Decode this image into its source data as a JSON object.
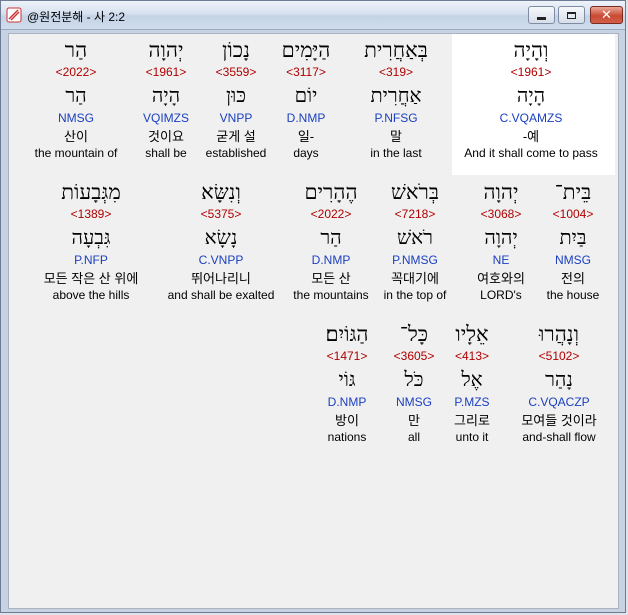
{
  "window": {
    "title": "@원전분해 - 사 2:2"
  },
  "rows": [
    {
      "words": [
        {
          "heb": "הַר",
          "strong": "<2022>",
          "lemma": "הַר",
          "parse": "NMSG",
          "kor": "산이",
          "eng": "the mountain of"
        },
        {
          "heb": "יְהוָה",
          "strong": "<1961>",
          "lemma": "הָיָה",
          "parse": "VQIMZS",
          "kor": "것이요",
          "eng": "shall be"
        },
        {
          "heb": "נָכוֹן",
          "strong": "<3559>",
          "lemma": "כּוּן",
          "parse": "VNPP",
          "kor": "굳게 설",
          "eng": "established"
        },
        {
          "heb": "הַיָּמִים",
          "strong": "<3117>",
          "lemma": "יוֹם",
          "parse": "D.NMP",
          "kor": "일-",
          "eng": "days"
        },
        {
          "heb": "בְּאַחֲרִית",
          "strong": "<319>",
          "lemma": "אַחֲרִית",
          "parse": "P.NFSG",
          "kor": "말",
          "eng": "in the last"
        },
        {
          "heb": "וְהָיָה",
          "strong": "<1961>",
          "lemma": "הָיָה",
          "parse": "C.VQAMZS",
          "kor": "-예",
          "eng": "And it shall come to pass"
        }
      ]
    },
    {
      "words": [
        {
          "heb": "מִגְּבָעוֹת",
          "strong": "<1389>",
          "lemma": "גִּבְעָה",
          "parse": "P.NFP",
          "kor": "모든 작은 산 위에",
          "eng": "above the hills"
        },
        {
          "heb": "וְנִשָּׂא",
          "strong": "<5375>",
          "lemma": "נָשָׂא",
          "parse": "C.VNPP",
          "kor": "뛰어나리니",
          "eng": "and shall be exalted"
        },
        {
          "heb": "הֶהָרִים",
          "strong": "<2022>",
          "lemma": "הַר",
          "parse": "D.NMP",
          "kor": "모든 산",
          "eng": "the mountains"
        },
        {
          "heb": "בְּרֹאשׁ",
          "strong": "<7218>",
          "lemma": "רֹאשׁ",
          "parse": "P.NMSG",
          "kor": "꼭대기에",
          "eng": "in the top of"
        },
        {
          "heb": "יְהוָה",
          "strong": "<3068>",
          "lemma": "יְהוָה",
          "parse": "NE",
          "kor": "여호와의",
          "eng": "LORD's"
        },
        {
          "heb": "בֵּית־",
          "strong": "<1004>",
          "lemma": "בַּיִת",
          "parse": "NMSG",
          "kor": "전의",
          "eng": "the house"
        }
      ]
    },
    {
      "words": [
        {
          "heb": "הַגּוֹיִם׃",
          "strong": "<1471>",
          "lemma": "גּוֹי",
          "parse": "D.NMP",
          "kor": "방이",
          "eng": "nations"
        },
        {
          "heb": "כָּל־",
          "strong": "<3605>",
          "lemma": "כֹּל",
          "parse": "NMSG",
          "kor": "만",
          "eng": "all"
        },
        {
          "heb": "אֵלָיו",
          "strong": "<413>",
          "lemma": "אֶל",
          "parse": "P.MZS",
          "kor": "그리로",
          "eng": "unto it"
        },
        {
          "heb": "וְנָהֲרוּ",
          "strong": "<5102>",
          "lemma": "נָהַר",
          "parse": "C.VQACZP",
          "kor": "모여들 것이라",
          "eng": "and-shall flow"
        }
      ]
    }
  ]
}
